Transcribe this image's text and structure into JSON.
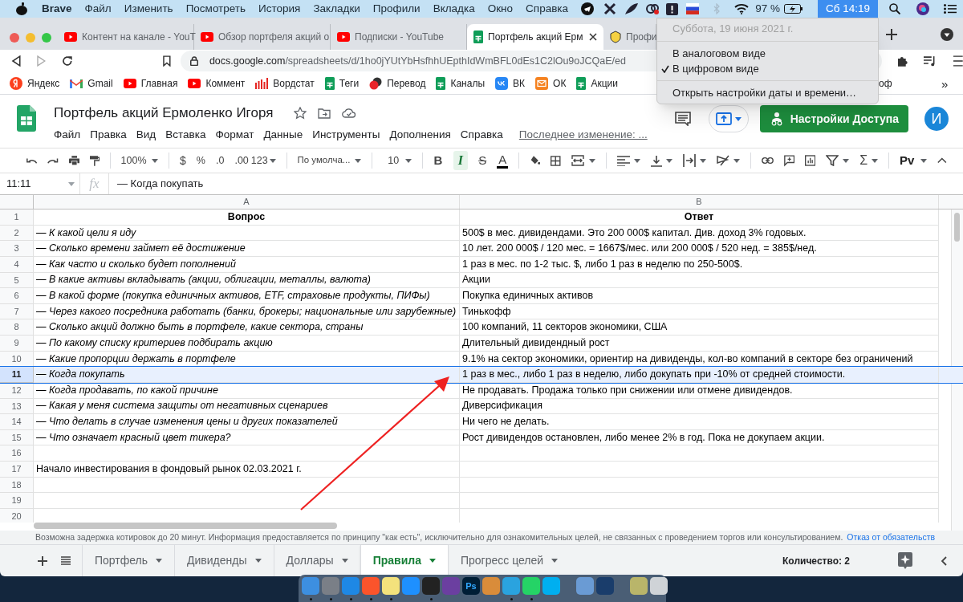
{
  "menubar": {
    "app": "Brave",
    "menus": [
      "Файл",
      "Изменить",
      "Посмотреть",
      "История",
      "Закладки",
      "Профили",
      "Вкладка",
      "Окно",
      "Справка"
    ],
    "battery": "97 %",
    "clock": "Сб 14:19"
  },
  "clock_menu": {
    "header": "Суббота, 19 июня 2021 г.",
    "items": [
      {
        "label": "В аналоговом виде",
        "checked": false
      },
      {
        "label": "В цифровом виде",
        "checked": true
      }
    ],
    "settings": "Открыть настройки даты и времени…"
  },
  "browser_tabs": [
    {
      "kind": "youtube",
      "title": "Контент на канале - YouT",
      "selected": false
    },
    {
      "kind": "youtube",
      "title": "Обзор портфеля акций о",
      "selected": false
    },
    {
      "kind": "youtube",
      "title": "Подписки - YouTube",
      "selected": false
    },
    {
      "kind": "sheets",
      "title": "Портфель акций Ерм",
      "selected": true
    },
    {
      "kind": "shield",
      "title": "Профи",
      "selected": false
    }
  ],
  "address": {
    "host": "docs.google.com",
    "path": "/spreadsheets/d/1ho0jYUtYbHsfhhUEpthIdWmBFL0dEs1C2lOu9oJCQaE/ed"
  },
  "bookmarks": [
    {
      "kind": "yandex",
      "label": "Яндекс"
    },
    {
      "kind": "gmail",
      "label": "Gmail"
    },
    {
      "kind": "youtube",
      "label": "Главная"
    },
    {
      "kind": "youtube",
      "label": "Коммент"
    },
    {
      "kind": "wordstat",
      "label": "Вордстат"
    },
    {
      "kind": "sheets",
      "label": "Теги"
    },
    {
      "kind": "translate",
      "label": "Перевод"
    },
    {
      "kind": "sheets",
      "label": "Каналы"
    },
    {
      "kind": "vk",
      "label": "ВК"
    },
    {
      "kind": "mail",
      "label": "ОК"
    },
    {
      "kind": "sheets",
      "label": "Акции"
    }
  ],
  "bookmarks_tail": "оф",
  "bookmarks_more": "»",
  "doc": {
    "title": "Портфель акций Ермоленко Игоря",
    "menus": [
      "Файл",
      "Правка",
      "Вид",
      "Вставка",
      "Формат",
      "Данные",
      "Инструменты",
      "Дополнения",
      "Справка"
    ],
    "last_edit": "Последнее изменение: ...",
    "share": "Настройки Доступа",
    "avatar": "И"
  },
  "toolbar": {
    "zoom": "100%",
    "currency": "$",
    "percent": "%",
    "dec_less": ".0",
    "dec_more": ".00",
    "format": "123",
    "font": "По умолча...",
    "font_size": "10",
    "bold": "B",
    "italic": "I",
    "italic_selected": true,
    "strike": "S",
    "text_color": "A",
    "sum": "Σ",
    "input": "Pv"
  },
  "formula_bar": {
    "cell": "11:11",
    "fx": "fx",
    "value": "— Когда покупать"
  },
  "sheet": {
    "columns": [
      "A",
      "B"
    ],
    "rows": [
      {
        "num": "1",
        "kind": "header",
        "a": "Вопрос",
        "b": "Ответ",
        "selected": false
      },
      {
        "num": "2",
        "kind": "question",
        "a": "— К какой цели я иду",
        "b": "500$ в мес. дивидендами. Это 200 000$ капитал. Див. доход 3% годовых.",
        "selected": false
      },
      {
        "num": "3",
        "kind": "question",
        "a": "— Сколько времени займет её достижение",
        "b": "10 лет. 200 000$ / 120 мес. = 1667$/мес. или 200 000$ / 520 нед. = 385$/нед.",
        "selected": false
      },
      {
        "num": "4",
        "kind": "question",
        "a": "— Как часто и сколько будет пополнений",
        "b": "1 раз в мес. по 1-2 тыс. $, либо 1 раз в неделю по 250-500$.",
        "selected": false
      },
      {
        "num": "5",
        "kind": "question",
        "a": "— В какие активы вкладывать (акции, облигации, металлы, валюта)",
        "b": "Акции",
        "selected": false
      },
      {
        "num": "6",
        "kind": "question",
        "a": "— В какой форме (покупка единичных активов, ETF, страховые продукты, ПИФы)",
        "b": "Покупка единичных активов",
        "selected": false
      },
      {
        "num": "7",
        "kind": "question",
        "a": "— Через какого посредника работать (банки, брокеры; национальные или зарубежные)",
        "b": "Тинькофф",
        "selected": false
      },
      {
        "num": "8",
        "kind": "question",
        "a": "— Сколько акций должно быть в портфеле, какие сектора, страны",
        "b": "100 компаний, 11 секторов экономики, США",
        "selected": false
      },
      {
        "num": "9",
        "kind": "question",
        "a": "— По какому списку критериев подбирать акцию",
        "b": "Длительный дивидендный рост",
        "selected": false
      },
      {
        "num": "10",
        "kind": "question",
        "a": "— Какие пропорции держать в портфеле",
        "b": "9.1% на сектор экономики, ориентир на дивиденды, кол-во компаний в секторе без ограничений",
        "selected": false
      },
      {
        "num": "11",
        "kind": "question",
        "a": "— Когда покупать",
        "b": "1 раз в мес., либо 1 раз в неделю, либо докупать при -10% от средней стоимости.",
        "selected": true
      },
      {
        "num": "12",
        "kind": "question",
        "a": "— Когда продавать, по какой причине",
        "b": "Не продавать. Продажа только при снижении или отмене дивидендов.",
        "selected": false
      },
      {
        "num": "13",
        "kind": "question",
        "a": "— Какая у меня система защиты от негативных сценариев",
        "b": "Диверсификация",
        "selected": false
      },
      {
        "num": "14",
        "kind": "question",
        "a": "— Что делать в случае изменения цены и других показателей",
        "b": "Ни чего не делать.",
        "selected": false
      },
      {
        "num": "15",
        "kind": "question",
        "a": "— Что означает красный цвет тикера?",
        "b": "Рост дивидендов остановлен, либо менее 2% в год. Пока не докупаем акции.",
        "selected": false
      },
      {
        "num": "16",
        "kind": "note",
        "selected": false
      },
      {
        "num": "17",
        "kind": "note",
        "a": "Начало инвестирования в фондовый рынок 02.03.2021 г.",
        "selected": false
      },
      {
        "num": "18",
        "kind": "note",
        "selected": false
      },
      {
        "num": "19",
        "kind": "note",
        "selected": false
      },
      {
        "num": "20",
        "kind": "note",
        "selected": false
      }
    ]
  },
  "disclaimer": {
    "text": "Возможна задержка котировок до 20 минут. Информация предоставляется по принципу \"как есть\", исключительно для ознакомительных целей, не связанных с проведением торгов или консультированием.",
    "link": "Отказ от обязательств"
  },
  "sheet_tabs": [
    {
      "label": "Портфель",
      "selected": false
    },
    {
      "label": "Дивиденды",
      "selected": false
    },
    {
      "label": "Доллары",
      "selected": false
    },
    {
      "label": "Правила",
      "selected": true
    },
    {
      "label": "Прогресс целей",
      "selected": false
    }
  ],
  "count": "Количество: 2",
  "dock": [
    {
      "color": "#3d8fe0",
      "running": true
    },
    {
      "color": "#7a7f87",
      "running": true
    },
    {
      "color": "#1e88e5",
      "running": true
    },
    {
      "color": "#fb542b",
      "running": true
    },
    {
      "color": "#f3e27c",
      "running": true
    },
    {
      "color": "#1e90ff",
      "running": false
    },
    {
      "color": "#222222",
      "running": true
    },
    {
      "color": "#6b3fa0",
      "running": false
    },
    {
      "color": "#001e36",
      "glyph": "Ps",
      "running": false
    },
    {
      "color": "#d98c3a",
      "running": false
    },
    {
      "color": "#2aa3df",
      "running": true
    },
    {
      "color": "#25d366",
      "running": true
    },
    {
      "color": "#00aff0",
      "running": false
    },
    {
      "color": "#6a9bd4",
      "running": false
    },
    {
      "color": "#1a3d6b",
      "running": false
    },
    {
      "color": "#b9b56a",
      "running": false
    },
    {
      "color": "#cfd3d7",
      "running": false
    }
  ]
}
